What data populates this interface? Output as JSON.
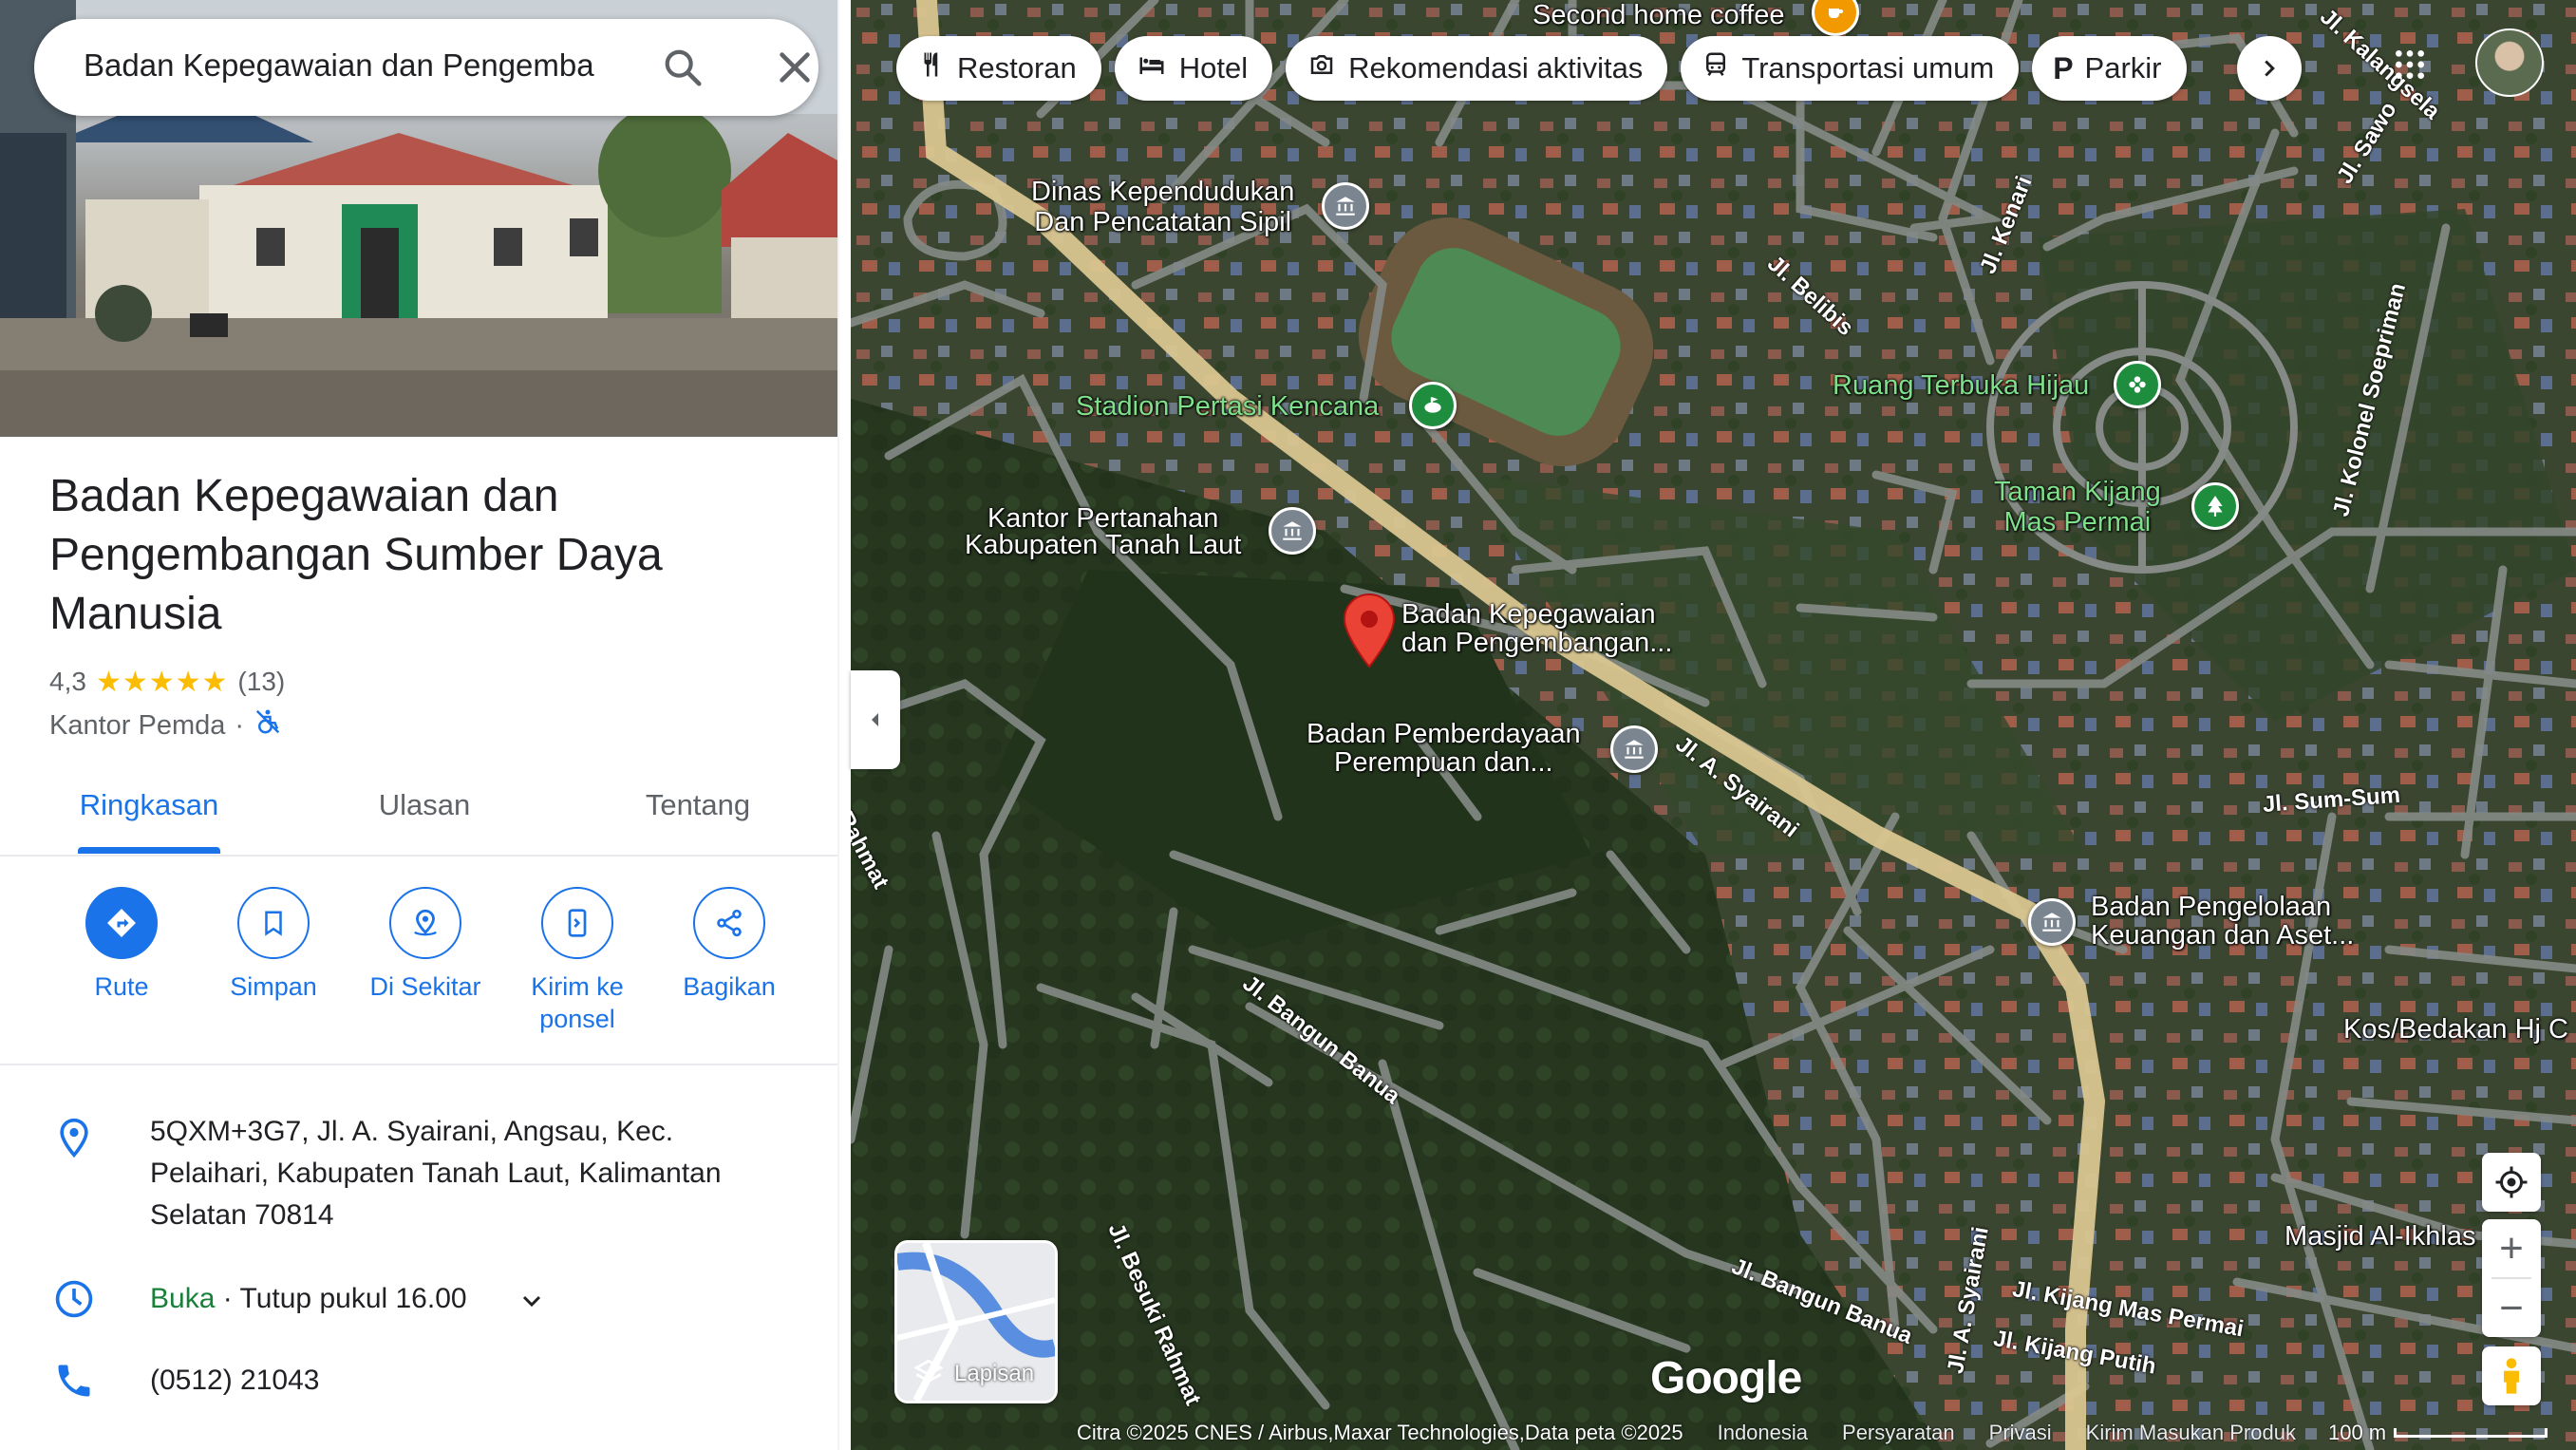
{
  "search": {
    "value": "Badan Kepegawaian dan Pengemba",
    "search_icon": "search-icon",
    "close_icon": "close-icon"
  },
  "place": {
    "title": "Badan Kepegawaian dan Pengembangan Sumber Daya Manusia",
    "rating": "4,3",
    "stars": "★★★★★",
    "stars_value": 4.3,
    "reviews": "(13)",
    "category": "Kantor Pemda",
    "separator": "·",
    "accessibility_icon": "wheelchair-not-accessible-icon"
  },
  "tabs": [
    {
      "label": "Ringkasan",
      "active": true
    },
    {
      "label": "Ulasan",
      "active": false
    },
    {
      "label": "Tentang",
      "active": false
    }
  ],
  "actions": [
    {
      "label": "Rute",
      "icon": "directions-icon"
    },
    {
      "label": "Simpan",
      "icon": "bookmark-icon"
    },
    {
      "label": "Di Sekitar",
      "icon": "nearby-icon"
    },
    {
      "label": "Kirim ke ponsel",
      "icon": "send-to-phone-icon"
    },
    {
      "label": "Bagikan",
      "icon": "share-icon"
    }
  ],
  "info": {
    "address": "5QXM+3G7, Jl. A. Syairani, Angsau, Kec. Pelaihari, Kabupaten Tanah Laut, Kalimantan Selatan 70814",
    "hours_open": "Buka",
    "hours_detail": " · Tutup pukul 16.00",
    "phone": "(0512) 21043"
  },
  "chips": [
    {
      "label": "Restoran",
      "icon": "restaurant-icon"
    },
    {
      "label": "Hotel",
      "icon": "hotel-icon"
    },
    {
      "label": "Rekomendasi aktivitas",
      "icon": "camera-icon"
    },
    {
      "label": "Transportasi umum",
      "icon": "transit-icon"
    },
    {
      "label": "Parkir",
      "icon": "parking-icon"
    }
  ],
  "map_labels": {
    "second_home": "Second home coffee",
    "dinas": "Dinas Kependudukan\nDan Pencatatan Sipil",
    "stadion": "Stadion Pertasi Kencana",
    "kantor_pertanahan": "Kantor Pertanahan\nKabupaten Tanah Laut",
    "selected_place": "Badan Kepegawaian\ndan Pengembangan...",
    "badan_pemberdayaan": "Badan Pemberdayaan\nPerempuan dan...",
    "ruang_terbuka": "Ruang Terbuka Hijau",
    "taman_kijang": "Taman Kijang\nMas Permai",
    "badan_pengelolaan": "Badan Pengelolaan\nKeuangan dan Aset...",
    "kos": "Kos/Bedakan Hj C",
    "masjid": "Masjid Al-Ikhlas"
  },
  "road_labels": {
    "syairani": "Jl. A. Syairani",
    "syairani2": "Jl. A. Syairani",
    "bangun_banua": "Jl. Bangun Banua",
    "bangun_banua2": "Jl. Bangun Banua",
    "besuki": "Jl. Besuki Rahmat",
    "rahmat": "Rahmat",
    "belibis": "Jl. Belibis",
    "kenari": "Jl. Kenari",
    "sawo": "Jl. Sawo",
    "sum_sum": "Jl. Sum-Sum",
    "kolonel": "Jl. Kolonel Soepriman",
    "kijang_mas": "Jl. Kijang Mas Permai",
    "kijang_putih": "Jl. Kijang Putih",
    "kalangsela": "Jl. Kalangsela"
  },
  "layers": {
    "label": "Lapisan",
    "icon": "layers-icon"
  },
  "controls": {
    "location_icon": "my-location-icon",
    "zoom_in": "+",
    "zoom_out": "−",
    "pegman_icon": "pegman-icon"
  },
  "brand": "Google",
  "attribution": {
    "imagery": "Citra ©2025 CNES / Airbus,Maxar Technologies,Data peta ©2025",
    "country": "Indonesia",
    "terms": "Persyaratan",
    "privacy": "Privasi",
    "feedback": "Kirim Masukan Produk",
    "scale": "100 m"
  },
  "colors": {
    "accent": "#1a73e8",
    "open": "#188038",
    "star": "#fbbc04",
    "pin": "#ea4335",
    "main_road": "#d9c690"
  }
}
